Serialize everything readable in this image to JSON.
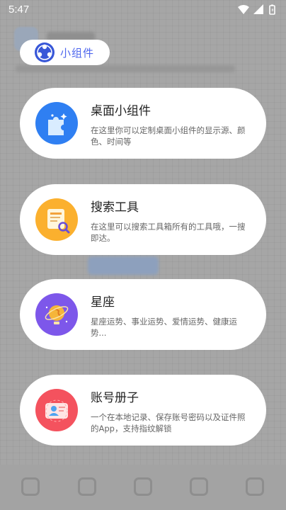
{
  "status_bar": {
    "time": "5:47",
    "icons": [
      "wifi-icon",
      "cell-signal-icon",
      "battery-icon"
    ]
  },
  "header": {
    "title": "小组件",
    "logo_icon": "globe-logo-icon",
    "title_color": "#4f67ee"
  },
  "cards": [
    {
      "title": "桌面小组件",
      "description": "在这里你可以定制桌面小组件的显示源、颜色、时间等",
      "icon": "puzzle-piece-icon",
      "icon_color": "#2f7ff2"
    },
    {
      "title": "搜索工具",
      "description": "在这里可以搜索工具箱所有的工具哦，一搜即达。",
      "icon": "document-search-icon",
      "icon_color": "#fbb02e"
    },
    {
      "title": "星座",
      "description": "星座运势、事业运势、爱情运势、健康运势...",
      "icon": "constellation-globe-icon",
      "icon_color": "#7d57ea"
    },
    {
      "title": "账号册子",
      "description": "一个在本地记录、保存账号密码以及证件照的App，支持指纹解锁",
      "icon": "id-card-icon",
      "icon_color": "#f4525e"
    }
  ]
}
